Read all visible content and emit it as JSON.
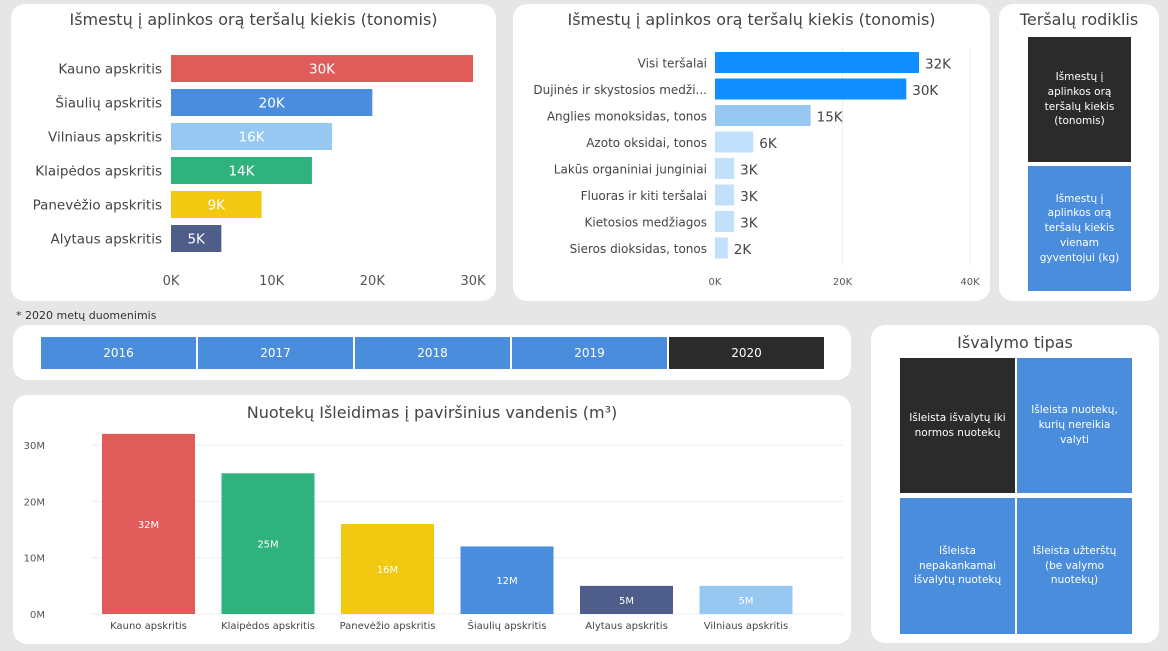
{
  "colors": {
    "red": "#e05c5a",
    "blue": "#4a8ddc",
    "lightblue": "#97c8f1",
    "green": "#2fb27d",
    "yellow": "#f2c811",
    "navy": "#4e5d8a",
    "brightblue": "#118dff",
    "paleblue": "#c2dffb",
    "dark": "#2b2b2b"
  },
  "chart1": {
    "title": "Išmestų į aplinkos orą teršalų kiekis (tonomis)",
    "chart_data": {
      "type": "bar",
      "orientation": "horizontal",
      "categories": [
        "Kauno apskritis",
        "Šiaulių apskritis",
        "Vilniaus apskritis",
        "Klaipėdos apskritis",
        "Panevėžio apskritis",
        "Alytaus apskritis"
      ],
      "values": [
        30000,
        20000,
        16000,
        14000,
        9000,
        5000
      ],
      "labels": [
        "30K",
        "20K",
        "16K",
        "14K",
        "9K",
        "5K"
      ],
      "bar_colors": [
        "#e05c5a",
        "#4a8ddc",
        "#97c8f1",
        "#2fb27d",
        "#f2c811",
        "#4e5d8a"
      ],
      "xlim": [
        0,
        30000
      ],
      "xticks": [
        0,
        10000,
        20000,
        30000
      ],
      "xtick_labels": [
        "0K",
        "10K",
        "20K",
        "30K"
      ]
    }
  },
  "chart2": {
    "title": "Išmestų į aplinkos orą teršalų kiekis (tonomis)",
    "chart_data": {
      "type": "bar",
      "orientation": "horizontal",
      "categories": [
        "Visi teršalai",
        "Dujinės ir skystosios medži...",
        "Anglies monoksidas, tonos",
        "Azoto oksidai, tonos",
        "Lakūs organiniai junginiai",
        "Fluoras ir kiti teršalai",
        "Kietosios medžiagos",
        "Sieros dioksidas, tonos"
      ],
      "values": [
        32000,
        30000,
        15000,
        6000,
        3000,
        3000,
        3000,
        2000
      ],
      "labels": [
        "32K",
        "30K",
        "15K",
        "6K",
        "3K",
        "3K",
        "3K",
        "2K"
      ],
      "bar_colors": [
        "#118dff",
        "#118dff",
        "#97c8f1",
        "#c2dffb",
        "#c2dffb",
        "#c2dffb",
        "#c2dffb",
        "#c2dffb"
      ],
      "xlim": [
        0,
        40000
      ],
      "xticks": [
        0,
        20000,
        40000
      ],
      "xtick_labels": [
        "0K",
        "20K",
        "40K"
      ],
      "grid": true
    }
  },
  "indicator": {
    "title": "Teršalų rodiklis",
    "items": [
      {
        "label": "Išmestų į aplinkos orą teršalų kiekis (tonomis)",
        "color": "#2b2b2b"
      },
      {
        "label": "Išmestų į aplinkos orą teršalų kiekis vienam gyventojui (kg)",
        "color": "#4a8ddc"
      }
    ]
  },
  "footnote": "* 2020 metų duomenimis",
  "years": {
    "items": [
      "2016",
      "2017",
      "2018",
      "2019",
      "2020"
    ],
    "selected": "2020"
  },
  "chart3": {
    "title": "Nuotekų Išleidimas į paviršinius vandenis (m³)",
    "chart_data": {
      "type": "bar",
      "orientation": "vertical",
      "categories": [
        "Kauno apskritis",
        "Klaipėdos apskritis",
        "Panevėžio apskritis",
        "Šiaulių apskritis",
        "Alytaus apskritis",
        "Vilniaus apskritis"
      ],
      "values": [
        32000000,
        25000000,
        16000000,
        12000000,
        5000000,
        5000000
      ],
      "labels": [
        "32M",
        "25M",
        "16M",
        "12M",
        "5M",
        "5M"
      ],
      "bar_colors": [
        "#e05c5a",
        "#2fb27d",
        "#f2c811",
        "#4a8ddc",
        "#4e5d8a",
        "#97c8f1"
      ],
      "ylim": [
        0,
        35000000
      ],
      "yticks": [
        0,
        10000000,
        20000000,
        30000000
      ],
      "ytick_labels": [
        "0M",
        "10M",
        "20M",
        "30M"
      ],
      "grid": true
    }
  },
  "cleaning": {
    "title": "Išvalymo tipas",
    "items": [
      {
        "label": "Išleista išvalytų iki normos nuotekų",
        "color": "#2b2b2b"
      },
      {
        "label": "Išleista nuotekų, kurių nereikia valyti",
        "color": "#4a8ddc"
      },
      {
        "label": "Išleista nepakankamai išvalytų nuotekų",
        "color": "#4a8ddc"
      },
      {
        "label": "Išleista užterštų (be valymo nuotekų)",
        "color": "#4a8ddc"
      }
    ]
  }
}
